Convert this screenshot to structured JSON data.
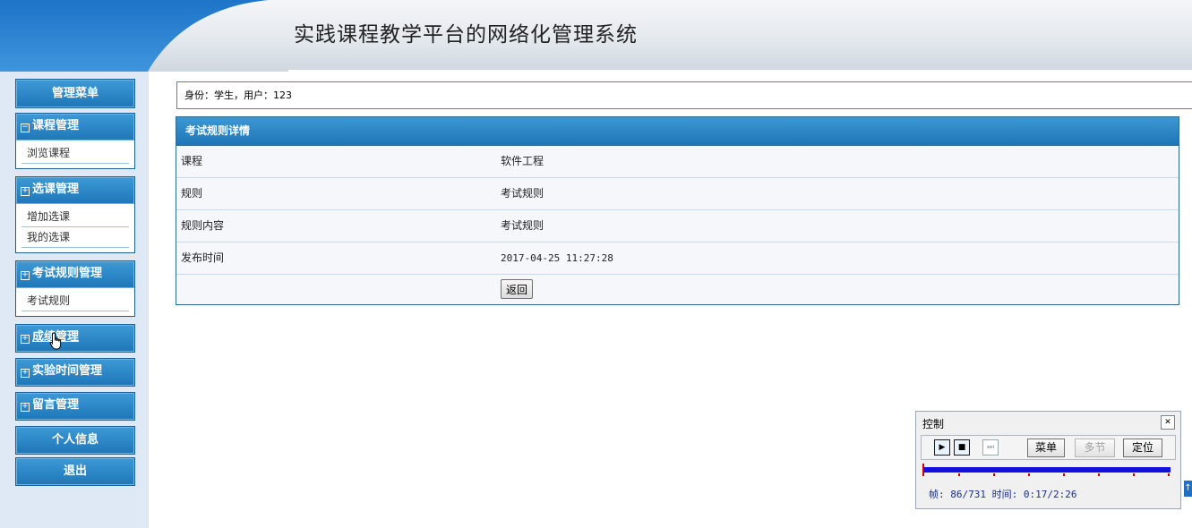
{
  "header": {
    "title": "实践课程教学平台的网络化管理系统"
  },
  "sidebar": {
    "menu_title": "管理菜单",
    "groups": [
      {
        "sign": "−",
        "label": "课程管理",
        "items": [
          "浏览课程"
        ]
      },
      {
        "sign": "+",
        "label": "选课管理",
        "items": [
          "增加选课",
          "我的选课"
        ]
      },
      {
        "sign": "+",
        "label": "考试规则管理",
        "items": [
          "考试规则"
        ]
      },
      {
        "sign": "+",
        "label": "成绩管理",
        "items": []
      },
      {
        "sign": "+",
        "label": "实验时间管理",
        "items": []
      },
      {
        "sign": "+",
        "label": "留言管理",
        "items": []
      }
    ],
    "personal_info": "个人信息",
    "logout": "退出"
  },
  "identity": "身份：学生，用户：123",
  "detail": {
    "title": "考试规则详情",
    "rows": [
      {
        "label": "课程",
        "value": "软件工程"
      },
      {
        "label": "规则",
        "value": "考试规则"
      },
      {
        "label": "规则内容",
        "value": "考试规则"
      },
      {
        "label": "发布时间",
        "value": "2017-04-25 11:27:28"
      }
    ],
    "back_label": "返回"
  },
  "control": {
    "title": "控制",
    "close_icon": "close-icon",
    "menu_label": "菜单",
    "multi_label": "多节",
    "locate_label": "定位",
    "status": "帧: 86/731 时间: 0:17/2:26",
    "progress": 0.0
  },
  "colors": {
    "accent": "#1f76b8",
    "header_blue": "#2a80cf",
    "sidebar_bg": "#dfe8f5",
    "progress_blue": "#1010e0",
    "marker_red": "#d00000"
  }
}
